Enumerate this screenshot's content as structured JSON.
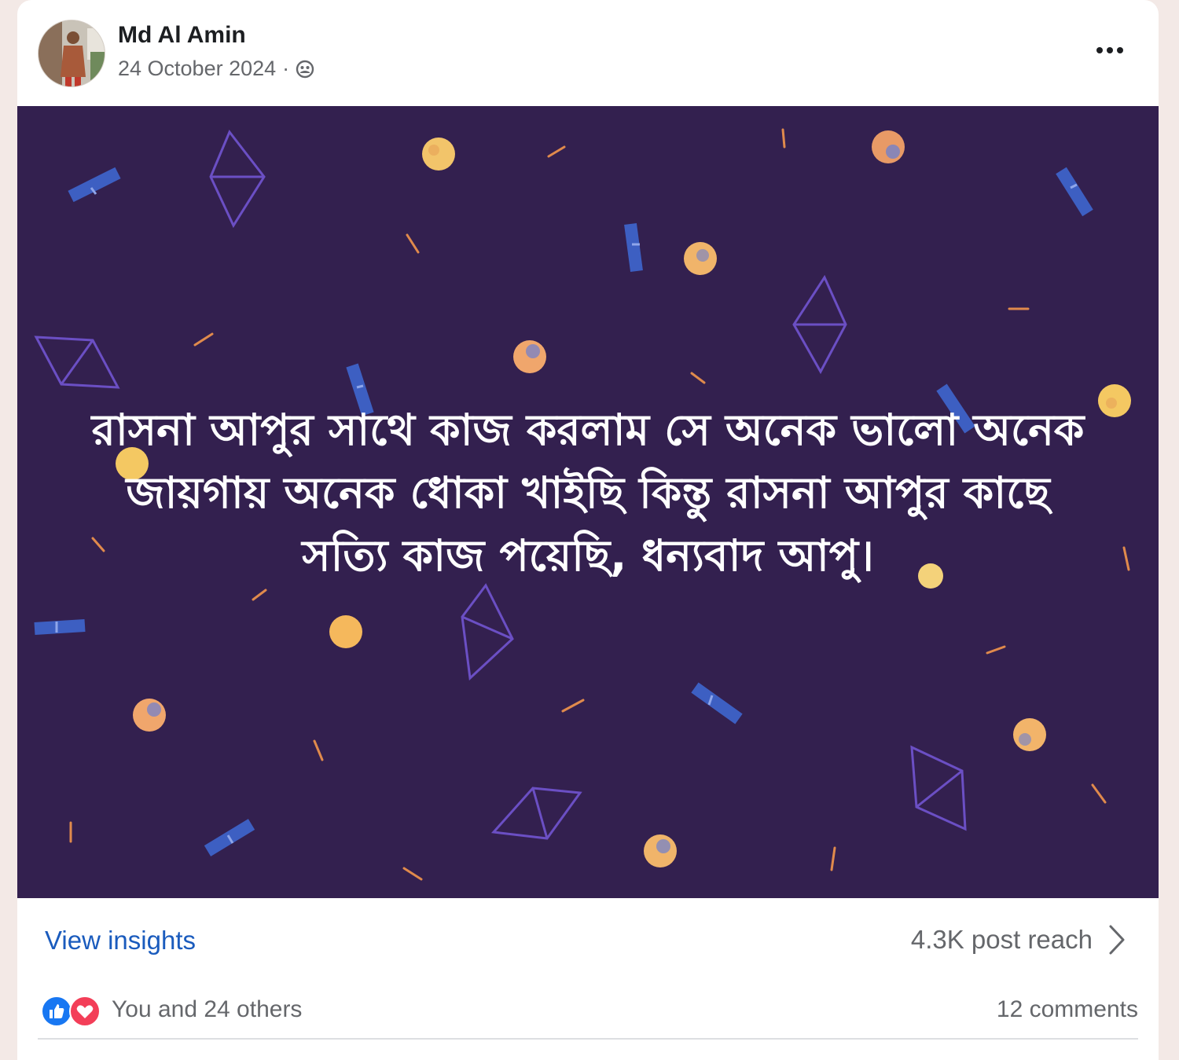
{
  "post": {
    "author_name": "Md Al Amin",
    "date": "24 October 2024",
    "date_separator": "·",
    "privacy_icon": "friends-icon",
    "more_icon": "more-dots-icon",
    "image": {
      "background_color": "#33204f",
      "text": "রাসনা আপুর সাথে কাজ করলাম সে অনেক ভালো অনেক জায়গায় অনেক ধোকা খাইছি কিন্তু রাসনা আপুর কাছে সত্যি কাজ পয়েছি, ধন্যবাদ আপু।"
    }
  },
  "insights": {
    "view_label": "View insights",
    "reach_text": "4.3K post reach",
    "chevron_icon": "chevron-right-icon",
    "link_color": "#1a5bbd"
  },
  "reactions": {
    "icons": [
      "like-icon",
      "love-icon"
    ],
    "summary": "You and 24 others",
    "comments": "12 comments",
    "like_color": "#1877f2",
    "love_color": "#f33e58"
  }
}
